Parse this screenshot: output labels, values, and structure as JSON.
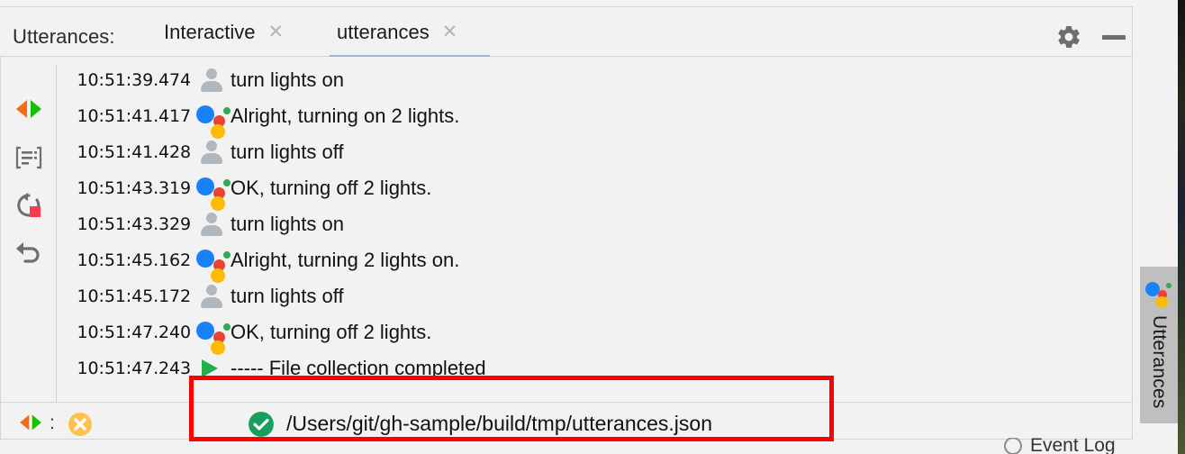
{
  "window": {
    "title_label": "Utterances:",
    "accent_active_tab": "#a3b2cc",
    "bg": "#f2f2f2"
  },
  "header": {
    "label": "Utterances:",
    "tabs": [
      {
        "label": "Interactive",
        "close_glyph": "✕",
        "active": false
      },
      {
        "label": "utterances",
        "close_glyph": "✕",
        "active": true
      }
    ],
    "buttons": [
      {
        "name": "settings-gear",
        "label": "Settings"
      },
      {
        "name": "minimize",
        "label": "Minimize"
      }
    ]
  },
  "left_toolbar": {
    "items": [
      {
        "icon": "compare-diff-icon",
        "label": "Compare with Clipboard"
      },
      {
        "icon": "soft-wrap-icon",
        "label": "Soft-Wrap"
      },
      {
        "icon": "rerun-stop-icon",
        "label": "Rerun"
      },
      {
        "icon": "undo-icon",
        "label": "Undo"
      }
    ]
  },
  "console": {
    "rows": [
      {
        "time": "10:51:39.474",
        "icon": "person-icon",
        "text": "turn lights on"
      },
      {
        "time": "10:51:41.417",
        "icon": "assistant-icon",
        "text": "Alright, turning on 2 lights."
      },
      {
        "time": "10:51:41.428",
        "icon": "person-icon",
        "text": "turn lights off"
      },
      {
        "time": "10:51:43.319",
        "icon": "assistant-icon",
        "text": "OK, turning off 2 lights."
      },
      {
        "time": "10:51:43.329",
        "icon": "person-icon",
        "text": "turn lights on"
      },
      {
        "time": "10:51:45.162",
        "icon": "assistant-icon",
        "text": "Alright, turning 2 lights on."
      },
      {
        "time": "10:51:45.172",
        "icon": "person-icon",
        "text": "turn lights off"
      },
      {
        "time": "10:51:47.240",
        "icon": "assistant-icon",
        "text": "OK, turning off 2 lights."
      },
      {
        "time": "10:51:47.243",
        "icon": "play-icon",
        "text": "----- File collection completed"
      }
    ]
  },
  "status_bar": {
    "diff_icon": "compare-diff-icon",
    "separator": ":",
    "error_badge_icon": "error-x-icon",
    "success_icon": "success-check-icon",
    "path": "/Users/git/gh-sample/build/tmp/utterances.json"
  },
  "side_tab": {
    "label": "Utterances",
    "icon": "google-assistant-icon"
  },
  "event_log": {
    "label": "Event Log",
    "icon": "circle-icon"
  },
  "annotation": {
    "color": "#ff0000",
    "description": "highlight box around file collection result"
  }
}
